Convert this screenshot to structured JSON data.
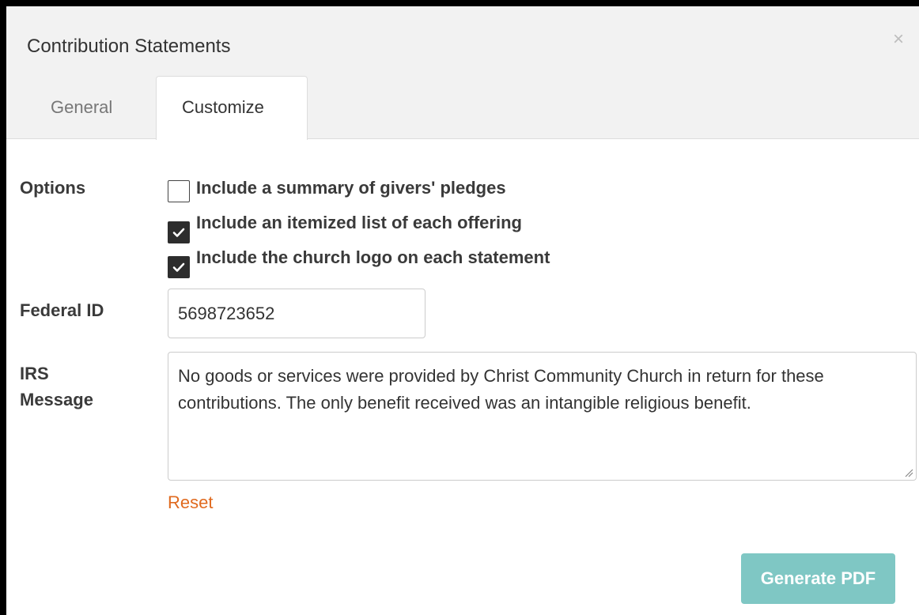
{
  "modal": {
    "title": "Contribution Statements",
    "close_icon": "close-icon",
    "close_glyph": "×"
  },
  "tabs": [
    {
      "label": "General",
      "active": false
    },
    {
      "label": "Customize",
      "active": true
    }
  ],
  "form": {
    "options_label": "Options",
    "options": [
      {
        "label": "Include a summary of givers' pledges",
        "checked": false
      },
      {
        "label": "Include an itemized list of each offering",
        "checked": true
      },
      {
        "label": "Include the church logo on each statement",
        "checked": true
      }
    ],
    "federal_id_label": "Federal ID",
    "federal_id_value": "5698723652",
    "irs_label_line1": "IRS",
    "irs_label_line2": "Message",
    "irs_message": "No goods or services were provided by Christ Community Church in return for these contributions. The only benefit received was an intangible religious benefit.",
    "reset_label": "Reset",
    "generate_label": "Generate PDF"
  },
  "colors": {
    "accent_link": "#e06a1f",
    "button_bg": "#7fc7c4",
    "header_bg": "#f2f2f2"
  }
}
